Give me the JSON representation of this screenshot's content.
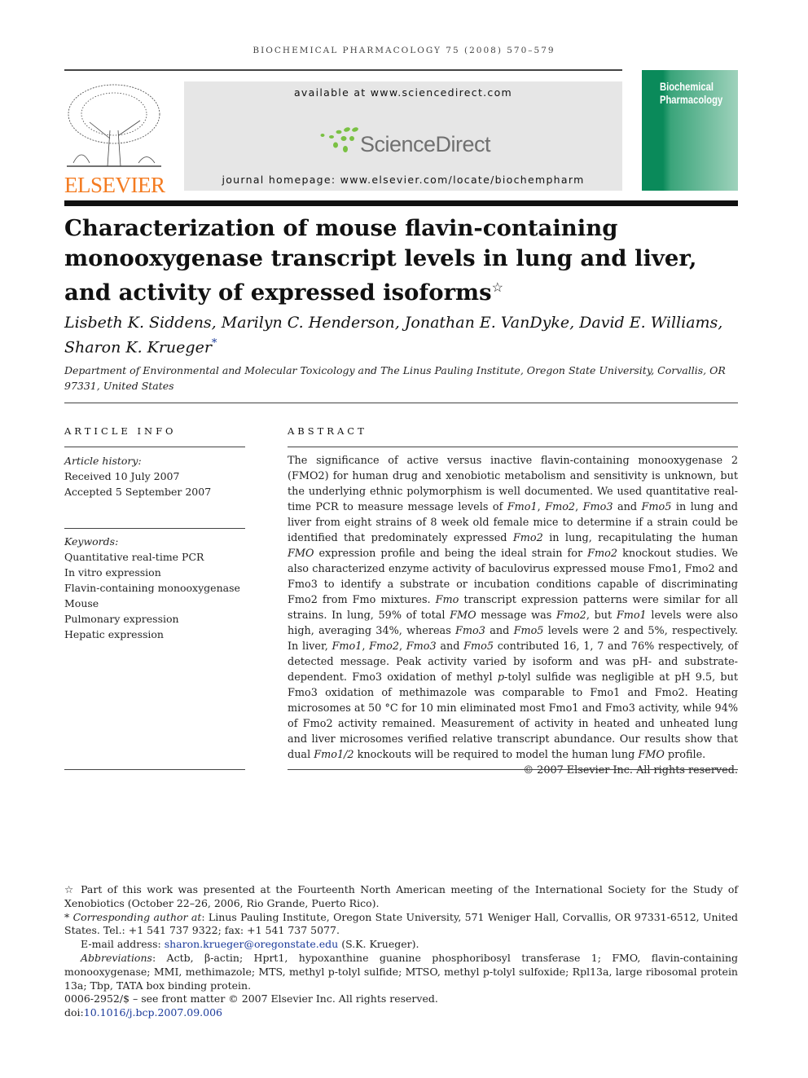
{
  "header": {
    "running_head": "BIOCHEMICAL PHARMACOLOGY 75 (2008) 570–579",
    "publisher_logo": "ELSEVIER",
    "available_at": "available at www.sciencedirect.com",
    "sciencedirect_logo": "ScienceDirect",
    "journal_homepage": "journal homepage: www.elsevier.com/locate/biochempharm",
    "cover_title": "Biochemical Pharmacology",
    "colors": {
      "elsevier": "#f47b20",
      "sciencedirect_dots": "#7ac143",
      "cover": "#0a8a5a"
    }
  },
  "article": {
    "title": "Characterization of mouse flavin-containing monooxygenase transcript levels in lung and liver, and activity of expressed isoforms",
    "title_mark": "☆",
    "authors": "Lisbeth K. Siddens, Marilyn C. Henderson, Jonathan E. VanDyke, David E. Williams, Sharon K. Krueger",
    "author_mark": "*",
    "affiliation": "Department of Environmental and Molecular Toxicology and The Linus Pauling Institute, Oregon State University, Corvallis, OR 97331, United States"
  },
  "article_info": {
    "heading": "ARTICLE INFO",
    "history_label": "Article history:",
    "received": "Received 10 July 2007",
    "accepted": "Accepted 5 September 2007",
    "keywords_label": "Keywords:",
    "keywords": [
      "Quantitative real-time PCR",
      "In vitro expression",
      "Flavin-containing monooxygenase",
      "Mouse",
      "Pulmonary expression",
      "Hepatic expression"
    ]
  },
  "abstract": {
    "heading": "ABSTRACT",
    "segments": [
      [
        "The significance of active versus inactive flavin-containing monooxygenase 2 (FMO2) for human drug and xenobiotic metabolism and sensitivity is unknown, but the underlying ethnic polymorphism is well documented. We used quantitative real-time PCR to measure message levels of ",
        0
      ],
      [
        "Fmo1",
        1
      ],
      [
        ", ",
        0
      ],
      [
        "Fmo2",
        1
      ],
      [
        ", ",
        0
      ],
      [
        "Fmo3",
        1
      ],
      [
        " and ",
        0
      ],
      [
        "Fmo5",
        1
      ],
      [
        " in lung and liver from eight strains of 8 week old female mice to determine if a strain could be identified that predominately expressed ",
        0
      ],
      [
        "Fmo2",
        1
      ],
      [
        " in lung, recapitulating the human ",
        0
      ],
      [
        "FMO",
        1
      ],
      [
        " expression profile and being the ideal strain for ",
        0
      ],
      [
        "Fmo2",
        1
      ],
      [
        " knockout studies. We also characterized enzyme activity of baculovirus expressed mouse Fmo1, Fmo2 and Fmo3 to identify a substrate or incubation conditions capable of discriminating Fmo2 from Fmo mixtures. ",
        0
      ],
      [
        "Fmo",
        1
      ],
      [
        " transcript expression patterns were similar for all strains. In lung, 59% of total ",
        0
      ],
      [
        "FMO",
        1
      ],
      [
        " message was ",
        0
      ],
      [
        "Fmo2",
        1
      ],
      [
        ", but ",
        0
      ],
      [
        "Fmo1",
        1
      ],
      [
        " levels were also high, averaging 34%, whereas ",
        0
      ],
      [
        "Fmo3",
        1
      ],
      [
        " and ",
        0
      ],
      [
        "Fmo5",
        1
      ],
      [
        " levels were 2 and 5%, respectively. In liver, ",
        0
      ],
      [
        "Fmo1",
        1
      ],
      [
        ", ",
        0
      ],
      [
        "Fmo2",
        1
      ],
      [
        ", ",
        0
      ],
      [
        "Fmo3",
        1
      ],
      [
        " and ",
        0
      ],
      [
        "Fmo5",
        1
      ],
      [
        " contributed 16, 1, 7 and 76% respectively, of detected message. Peak activity varied by isoform and was pH- and substrate-dependent. Fmo3 oxidation of methyl ",
        0
      ],
      [
        "p",
        1
      ],
      [
        "-tolyl sulfide was negligible at pH 9.5, but Fmo3 oxidation of methimazole was comparable to Fmo1 and Fmo2. Heating microsomes at 50 °C for 10 min eliminated most Fmo1 and Fmo3 activity, while 94% of Fmo2 activity remained. Measurement of activity in heated and unheated lung and liver microsomes verified relative transcript abundance. Our results show that dual ",
        0
      ],
      [
        "Fmo1/2",
        1
      ],
      [
        " knockouts will be required to model the human lung ",
        0
      ],
      [
        "FMO",
        1
      ],
      [
        " profile.",
        0
      ]
    ],
    "copyright": "© 2007 Elsevier Inc. All rights reserved."
  },
  "footnotes": {
    "star_note": "☆ Part of this work was presented at the Fourteenth North American meeting of the International Society for the Study of Xenobiotics (October 22–26, 2006, Rio Grande, Puerto Rico).",
    "corr_mark": "* ",
    "corr_label": "Corresponding author at",
    "corr_text": ": Linus Pauling Institute, Oregon State University, 571 Weniger Hall, Corvallis, OR 97331-6512, United States. Tel.: +1 541 737 9322; fax: +1 541 737 5077.",
    "email_label": "E-mail address: ",
    "email": "sharon.krueger@oregonstate.edu",
    "email_suffix": " (S.K. Krueger).",
    "abbr_label": "Abbreviations",
    "abbr_text": ": Actb, β-actin; Hprt1, hypoxanthine guanine phosphoribosyl transferase 1; FMO, flavin-containing monooxygenase; MMI, methimazole; MTS, methyl p-tolyl sulfide; MTSO, methyl p-tolyl sulfoxide; Rpl13a, large ribosomal protein 13a; Tbp, TATA box binding protein.",
    "issn": "0006-2952/$ – see front matter © 2007 Elsevier Inc. All rights reserved.",
    "doi_label": "doi:",
    "doi": "10.1016/j.bcp.2007.09.006"
  }
}
